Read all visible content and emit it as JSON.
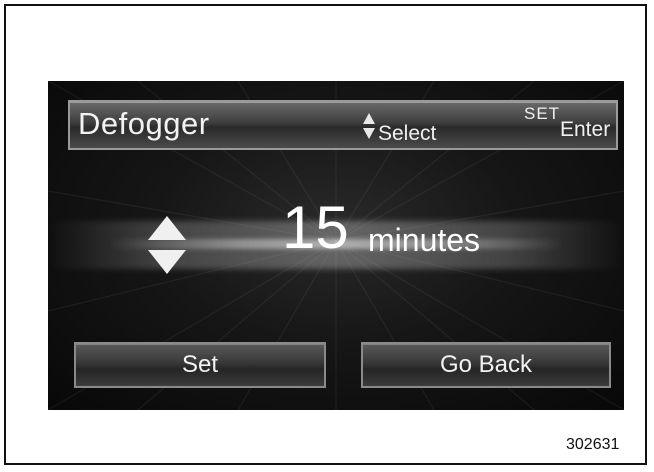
{
  "header": {
    "title": "Defogger",
    "select_hint": "Select",
    "set_label": "SET",
    "enter_hint": "Enter"
  },
  "setting": {
    "value": "15",
    "unit": "minutes"
  },
  "buttons": {
    "set_label": "Set",
    "back_label": "Go Back"
  },
  "figure_number": "302631",
  "icons": {
    "hint_arrows": "up-down-arrows-icon",
    "stepper": "up-down-arrows-icon"
  },
  "colors": {
    "screen_background": "#111111",
    "text": "#ffffff",
    "button_border": "#8a8a8a"
  }
}
